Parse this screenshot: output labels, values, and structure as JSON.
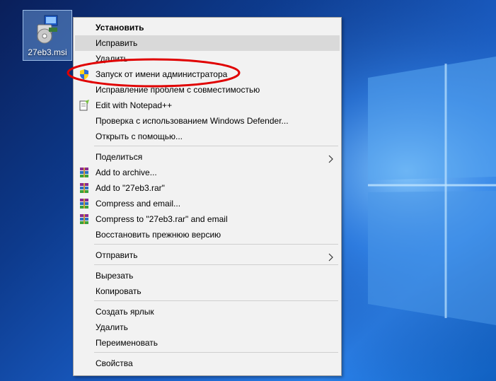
{
  "desktop": {
    "file": {
      "name": "27eb3.msi",
      "icon": "msi-installer-icon"
    }
  },
  "menu": {
    "items": [
      {
        "label": "Установить",
        "bold": true,
        "icon": ""
      },
      {
        "label": "Исправить",
        "hover": true,
        "icon": ""
      },
      {
        "label": "Удалить",
        "icon": ""
      },
      {
        "label": "Запуск от имени администратора",
        "icon": "uac-shield-icon"
      },
      {
        "label": "Исправление проблем с совместимостью",
        "icon": ""
      },
      {
        "label": "Edit with Notepad++",
        "icon": "notepad-plus-plus-icon"
      },
      {
        "label": "Проверка с использованием Windows Defender...",
        "icon": ""
      },
      {
        "label": "Открыть с помощью...",
        "icon": ""
      },
      {
        "label": "Поделиться",
        "submenu": true,
        "icon": ""
      },
      {
        "label": "Add to archive...",
        "icon": "winrar-icon"
      },
      {
        "label": "Add to \"27eb3.rar\"",
        "icon": "winrar-icon"
      },
      {
        "label": "Compress and email...",
        "icon": "winrar-icon"
      },
      {
        "label": "Compress to \"27eb3.rar\" and email",
        "icon": "winrar-icon"
      },
      {
        "label": "Восстановить прежнюю версию",
        "icon": ""
      },
      {
        "label": "Отправить",
        "submenu": true,
        "icon": ""
      },
      {
        "label": "Вырезать",
        "icon": ""
      },
      {
        "label": "Копировать",
        "icon": ""
      },
      {
        "label": "Создать ярлык",
        "icon": ""
      },
      {
        "label": "Удалить",
        "icon": ""
      },
      {
        "label": "Переименовать",
        "icon": ""
      },
      {
        "label": "Свойства",
        "icon": ""
      }
    ]
  },
  "annotation": {
    "color": "#e00000",
    "target": "Запуск от имени администратора"
  }
}
